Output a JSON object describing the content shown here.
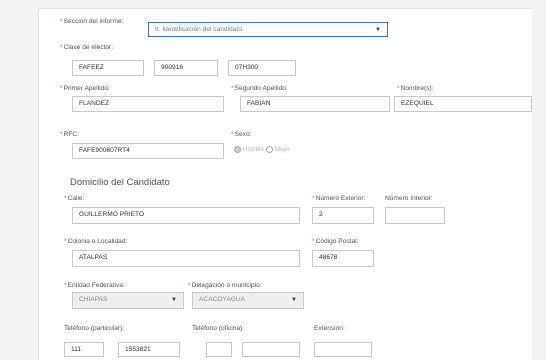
{
  "section": {
    "label": "Sección del informe:",
    "value": "II. Identificación del candidato"
  },
  "clave": {
    "label": "Clave de elector:",
    "part1": "FAFEEZ",
    "part2": "900916",
    "part3": "07H300"
  },
  "primer_apellido": {
    "label": "Primer Apellido:",
    "value": "FLANDEZ"
  },
  "segundo_apellido": {
    "label": "Segundo Apellido:",
    "value": "FABIAN"
  },
  "nombres": {
    "label": "Nombre(s):",
    "value": "EZEQUIEL"
  },
  "rfc": {
    "label": "RFC:",
    "value": "FAFE900607RT4"
  },
  "sexo": {
    "label": "Sexo:",
    "options": [
      "Hombre",
      "Mujer"
    ],
    "selected": "Hombre"
  },
  "domicilio": {
    "title": "Domicilio del Candidato"
  },
  "calle": {
    "label": "Calle:",
    "value": "GUILLERMO PRIETO"
  },
  "num_ext": {
    "label": "Número Exterior:",
    "value": "2"
  },
  "num_int": {
    "label": "Número Interior:",
    "value": ""
  },
  "colonia": {
    "label": "Colonia o Localidad:",
    "value": "ATALPAS"
  },
  "cp": {
    "label": "Código Postal:",
    "value": "48678"
  },
  "entidad": {
    "label": "Entidad Federativa:",
    "value": "CHIAPAS"
  },
  "delegacion": {
    "label": "Delegación o municipio:",
    "value": "ACACOYAGUA"
  },
  "tel_particular": {
    "label": "Teléfono (particular):",
    "lada": "111",
    "numero": "1553821"
  },
  "tel_oficina": {
    "label": "Teléfono (oficina):",
    "lada": "",
    "numero": ""
  },
  "extension": {
    "label": "Extensión:",
    "value": ""
  },
  "icons": {
    "caret": "chevron-down-icon",
    "radio": "radio-icon"
  }
}
